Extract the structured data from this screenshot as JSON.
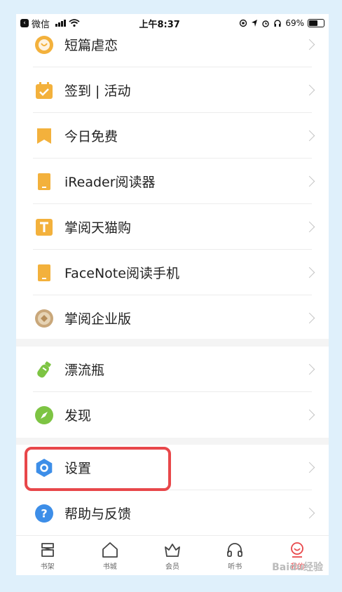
{
  "status_bar": {
    "back_app": "微信",
    "time": "上午8:37",
    "battery": "69%",
    "battery_level": 0.69
  },
  "menu": {
    "section1": [
      {
        "label": "短篇虐恋",
        "icon": "heart-face-icon",
        "color": "#f3b13c"
      },
      {
        "label": "签到 | 活动",
        "icon": "calendar-check-icon",
        "color": "#f3b13c"
      },
      {
        "label": "今日免费",
        "icon": "bookmark-icon",
        "color": "#f3b13c"
      },
      {
        "label": "iReader阅读器",
        "icon": "ereader-icon",
        "color": "#f3b13c"
      },
      {
        "label": "掌阅天猫购",
        "icon": "tmall-icon",
        "color": "#f3b13c"
      },
      {
        "label": "FaceNote阅读手机",
        "icon": "phone-icon",
        "color": "#f3b13c"
      },
      {
        "label": "掌阅企业版",
        "icon": "enterprise-icon",
        "color": "#c9a77a"
      }
    ],
    "section2": [
      {
        "label": "漂流瓶",
        "icon": "bottle-icon",
        "color": "#7dc443"
      },
      {
        "label": "发现",
        "icon": "compass-icon",
        "color": "#7dc443"
      }
    ],
    "section3": [
      {
        "label": "设置",
        "icon": "settings-hexagon-icon",
        "color": "#3d8ee8"
      },
      {
        "label": "帮助与反馈",
        "icon": "help-icon",
        "color": "#3d8ee8"
      }
    ]
  },
  "tabbar": {
    "tabs": [
      {
        "label": "书架",
        "icon": "bookshelf-icon"
      },
      {
        "label": "书城",
        "icon": "bookstore-icon"
      },
      {
        "label": "会员",
        "icon": "vip-crown-icon"
      },
      {
        "label": "听书",
        "icon": "headphones-icon"
      },
      {
        "label": "我的",
        "icon": "profile-icon",
        "active": true,
        "active_color": "#e8474a"
      }
    ]
  },
  "watermark": "Baidu经验",
  "highlight_color": "#e8474a"
}
